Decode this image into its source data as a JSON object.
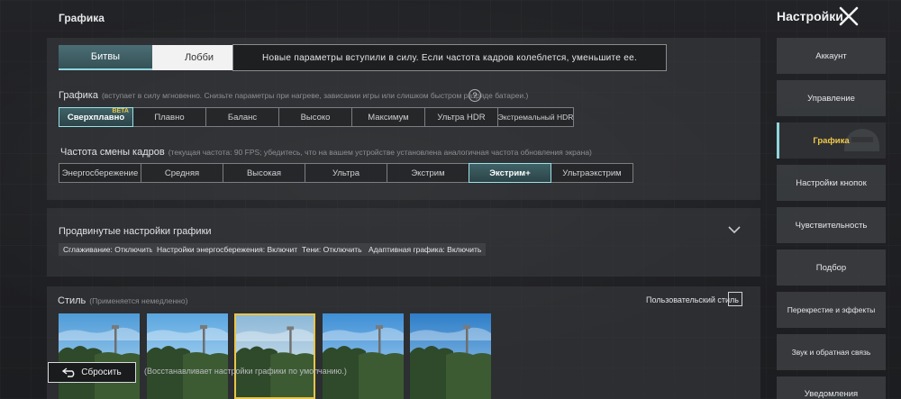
{
  "header": {
    "title": "Графика",
    "settings_title": "Настройки"
  },
  "tabs": [
    {
      "label": "Битвы",
      "active": true
    },
    {
      "label": "Лобби",
      "active": false
    }
  ],
  "notice": "Новые параметры вступили в силу. Если частота кадров колеблется, уменьшите ее.",
  "graphics": {
    "label": "Графика",
    "note": "(вступает в силу мгновенно. Снизьте параметры при нагреве, зависании игры или слишком быстром разряде батареи.)",
    "help": "?",
    "options": [
      "Сверхплавно",
      "Плавно",
      "Баланс",
      "Высоко",
      "Максимум",
      "Ультра HDR",
      "Экстремальный HDR"
    ],
    "selected": "Сверхплавно",
    "beta_label": "BETA"
  },
  "fps": {
    "label": "Частота смены кадров",
    "note": "(текущая частота: 90 FPS; убедитесь, что на вашем устройстве установлена аналогичная частота обновления экрана)",
    "options": [
      "Энергосбережение",
      "Средняя",
      "Высокая",
      "Ультра",
      "Экстрим",
      "Экстрим+",
      "Ультраэкстрим"
    ],
    "selected": "Экстрим+"
  },
  "advanced": {
    "title": "Продвинутые настройки графики",
    "chips": [
      "Сглаживание: Отключить",
      "Настройки энергосбережения: Включить",
      "Тени: Отключить",
      "Адаптивная графика: Включить"
    ]
  },
  "style": {
    "label": "Стиль",
    "note": "(Применяется немедленно)",
    "custom_label": "Пользовательский стиль",
    "selected_index": 2,
    "count": 5
  },
  "reset": {
    "label": "Сбросить",
    "note": "(Восстанавливает настройки графики по умолчанию.)"
  },
  "sidebar": {
    "items": [
      {
        "label": "Аккаунт",
        "active": false
      },
      {
        "label": "Управление",
        "active": false
      },
      {
        "label": "Графика",
        "active": true
      },
      {
        "label": "Настройки кнопок",
        "active": false
      },
      {
        "label": "Чувствительность",
        "active": false
      },
      {
        "label": "Подбор",
        "active": false
      },
      {
        "label": "Перекрестие и эффекты",
        "active": false
      },
      {
        "label": "Звук и обратная связь",
        "active": false
      },
      {
        "label": "Уведомления",
        "active": false
      }
    ]
  },
  "colors": {
    "accent_teal": "#8fd6dc",
    "accent_gold": "#e7c54a"
  },
  "icons": {
    "close": "close-icon",
    "help": "help-icon",
    "chevron": "chevron-down-icon",
    "reset": "reset-icon"
  }
}
